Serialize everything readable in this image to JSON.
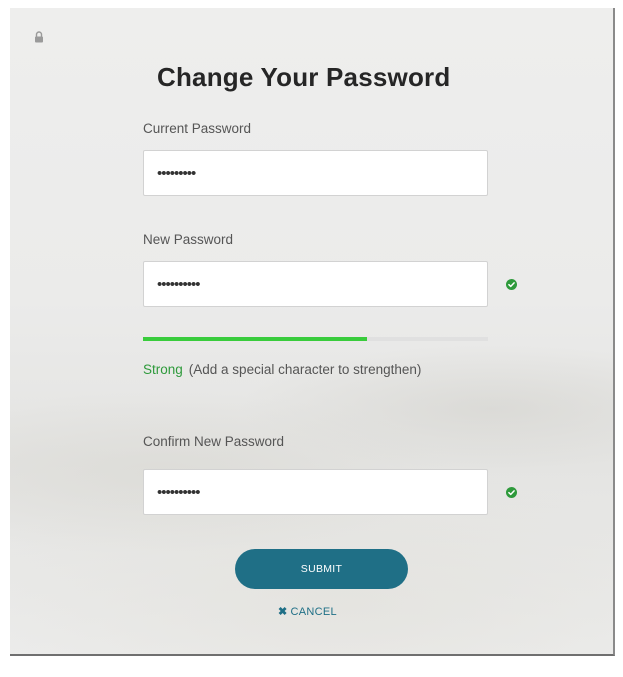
{
  "header": {
    "icon": "lock-icon",
    "title": "Change Your Password"
  },
  "fields": {
    "current": {
      "label": "Current Password",
      "value": "•••••••••"
    },
    "new": {
      "label": "New Password",
      "value": "••••••••••",
      "valid_icon": "check-circle-icon"
    },
    "confirm": {
      "label": "Confirm New Password",
      "value": "••••••••••",
      "valid_icon": "check-circle-icon"
    }
  },
  "strength": {
    "level_fraction": 0.65,
    "rating": "Strong",
    "hint": "(Add a special character to strengthen)"
  },
  "actions": {
    "submit_label": "SUBMIT",
    "cancel_icon": "close-icon",
    "cancel_label": "CANCEL"
  },
  "colors": {
    "accent": "#1f6f86",
    "success": "#2e9a3b",
    "strength_bar": "#39cc3c"
  }
}
